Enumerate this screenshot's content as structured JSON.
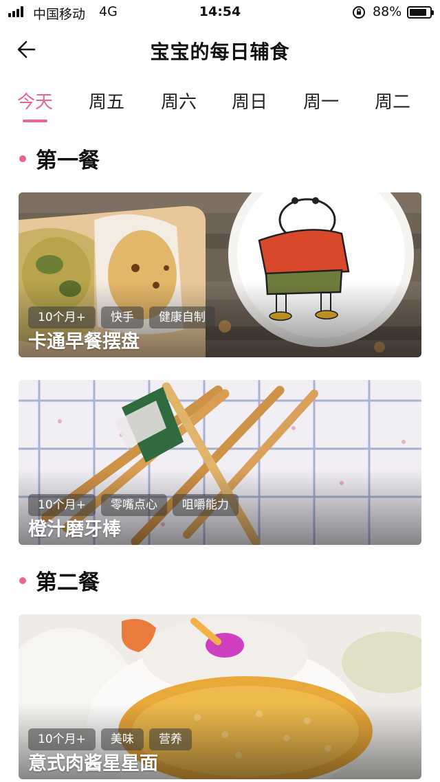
{
  "status_bar": {
    "carrier": "中国移动",
    "network": "4G",
    "time": "14:54",
    "battery": "88%",
    "battery_level": 0.88,
    "icons": [
      "signal-icon",
      "orientation-lock-icon",
      "battery-icon"
    ]
  },
  "header": {
    "title": "宝宝的每日辅食",
    "back_icon": "arrow-left-icon"
  },
  "tabs": [
    {
      "label": "今天",
      "active": true
    },
    {
      "label": "周五",
      "active": false
    },
    {
      "label": "周六",
      "active": false
    },
    {
      "label": "周日",
      "active": false
    },
    {
      "label": "周一",
      "active": false
    },
    {
      "label": "周二",
      "active": false
    }
  ],
  "sections": [
    {
      "title": "第一餐",
      "cards": [
        {
          "title": "卡通早餐摆盘",
          "tags": [
            "10个月+",
            "快手",
            "健康自制"
          ]
        },
        {
          "title": "橙汁磨牙棒",
          "tags": [
            "10个月+",
            "零嘴点心",
            "咀嚼能力"
          ]
        }
      ]
    },
    {
      "title": "第二餐",
      "cards": [
        {
          "title": "意式肉酱星星面",
          "tags": [
            "10个月+",
            "美味",
            "营养"
          ]
        }
      ]
    }
  ],
  "colors": {
    "accent": "#e9678c",
    "text": "#111111"
  }
}
